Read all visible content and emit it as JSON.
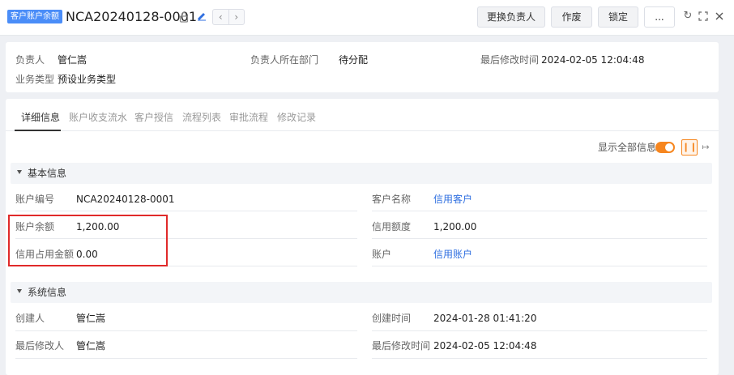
{
  "header": {
    "tag": "客户账户余额",
    "record_title": "NCA20240128-0001",
    "buttons": {
      "change_owner": "更换负责人",
      "void": "作废",
      "lock": "锁定",
      "more": "..."
    },
    "nav": {
      "prev": "‹",
      "next": "›"
    }
  },
  "summary": {
    "owner_label": "负责人",
    "owner_value": "管仁嵩",
    "dept_label": "负责人所在部门",
    "dept_value": "待分配",
    "modified_label": "最后修改时间",
    "modified_value": "2024-02-05 12:04:48",
    "biztype_label": "业务类型",
    "biztype_value": "预设业务类型"
  },
  "tabs": [
    "详细信息",
    "账户收支流水",
    "客户授信",
    "流程列表",
    "审批流程",
    "修改记录"
  ],
  "toolbar": {
    "show_all_label": "显示全部信息",
    "show_all_on": true
  },
  "sections": {
    "basic": {
      "title": "基本信息",
      "account_no_label": "账户编号",
      "account_no_value": "NCA20240128-0001",
      "customer_label": "客户名称",
      "customer_value": "信用客户",
      "balance_label": "账户余额",
      "balance_value": "1,200.00",
      "credit_limit_label": "信用额度",
      "credit_limit_value": "1,200.00",
      "credit_used_label": "信用占用金额",
      "credit_used_value": "0.00",
      "account_label": "账户",
      "account_value": "信用账户"
    },
    "system": {
      "title": "系统信息",
      "creator_label": "创建人",
      "creator_value": "管仁嵩",
      "created_label": "创建时间",
      "created_value": "2024-01-28 01:41:20",
      "modifier_label": "最后修改人",
      "modifier_value": "管仁嵩",
      "modified_label": "最后修改时间",
      "modified_value": "2024-02-05 12:04:48"
    }
  },
  "colors": {
    "accent": "#f6861f",
    "link": "#2f6fe0",
    "tag": "#4a8df8",
    "highlight": "#e02a2a"
  }
}
